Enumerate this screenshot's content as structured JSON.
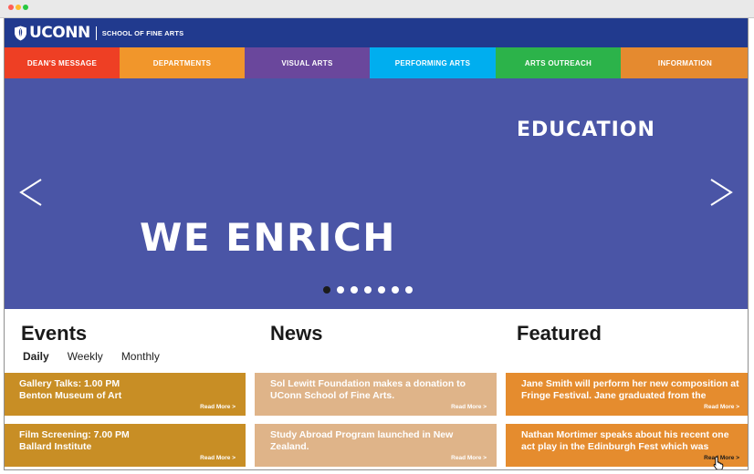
{
  "brand": {
    "logo_text": "UCONN",
    "subtitle": "SCHOOL OF FINE ARTS"
  },
  "colors": {
    "topbar": "#213a8e",
    "hero": "#4a55a6"
  },
  "nav": [
    {
      "label": "DEAN'S MESSAGE",
      "color": "#ee3f24"
    },
    {
      "label": "DEPARTMENTS",
      "color": "#f1962b"
    },
    {
      "label": "VISUAL ARTS",
      "color": "#6a479c"
    },
    {
      "label": "PERFORMING ARTS",
      "color": "#00aeef"
    },
    {
      "label": "ARTS OUTREACH",
      "color": "#2cb34a"
    },
    {
      "label": "INFORMATION",
      "color": "#e58a2f"
    }
  ],
  "hero": {
    "word_top": "EDUCATION",
    "word_main": "WE ENRICH",
    "prev_icon": "chevron-left-icon",
    "next_icon": "chevron-right-icon",
    "slide_count": 7,
    "active_slide": 1
  },
  "events": {
    "title": "Events",
    "tabs": [
      "Daily",
      "Weekly",
      "Monthly"
    ],
    "active_tab": "Daily",
    "cards": [
      {
        "text": "Gallery Talks: 1.00 PM\nBenton Museum of Art",
        "more": "Read More >"
      },
      {
        "text": "Film Screening: 7.00 PM\nBallard Institute",
        "more": "Read More >"
      }
    ]
  },
  "news": {
    "title": "News",
    "cards": [
      {
        "text": "Sol Lewitt Foundation makes a donation to UConn School of Fine Arts.",
        "more": "Read More >"
      },
      {
        "text": "Study Abroad Program launched in New Zealand.",
        "more": "Read More >"
      }
    ]
  },
  "featured": {
    "title": "Featured",
    "cards": [
      {
        "text": "Jane Smith will perform her new composition at Fringe Festival. Jane graduated from the",
        "more": "Read More >"
      },
      {
        "text": "Nathan Mortimer speaks about his recent one act play in the Edinburgh Fest which was",
        "more": "Read More >"
      }
    ]
  }
}
